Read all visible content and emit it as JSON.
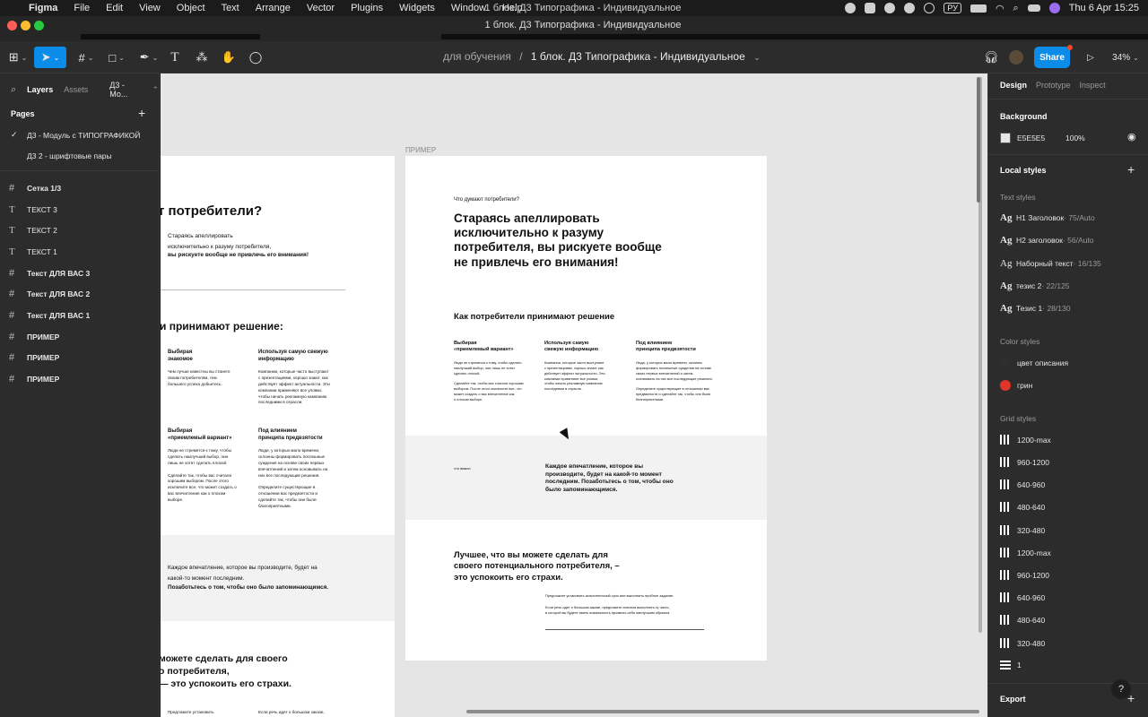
{
  "menubar": {
    "app": "Figma",
    "items": [
      "File",
      "Edit",
      "View",
      "Object",
      "Text",
      "Arrange",
      "Vector",
      "Plugins",
      "Widgets",
      "Window",
      "Help"
    ],
    "window_title": "1 блок. Д3 Типографика - Индивидуальное",
    "input_source": "РУ",
    "clock": "Thu 6 Apr  15:25"
  },
  "toolbar": {
    "breadcrumb_project": "для обучения",
    "breadcrumb_sep": "/",
    "breadcrumb_file": "1 блок. Д3 Типографика - Индивидуальное",
    "share_label": "Share",
    "zoom": "34%"
  },
  "left_panel": {
    "tabs": [
      "Layers",
      "Assets",
      "Д3 - Мо..."
    ],
    "pages_title": "Pages",
    "pages": [
      {
        "label": "Д3 - Модуль с ТИПОГРАФИКОЙ",
        "current": true
      },
      {
        "label": "Д3 2 - шрифтовые пары",
        "current": false
      }
    ],
    "layers": [
      {
        "label": "Сетка 1/3",
        "type": "frame"
      },
      {
        "label": "ТЕКСТ 3",
        "type": "text"
      },
      {
        "label": "ТЕКСТ 2",
        "type": "text"
      },
      {
        "label": "ТЕКСТ 1",
        "type": "text"
      },
      {
        "label": "Текст ДЛЯ ВАС 3",
        "type": "frame"
      },
      {
        "label": "Текст ДЛЯ ВАС 2",
        "type": "frame"
      },
      {
        "label": "Текст ДЛЯ ВАС 1",
        "type": "frame"
      },
      {
        "label": "ПРИМЕР",
        "type": "frame"
      },
      {
        "label": "ПРИМЕР",
        "type": "frame"
      },
      {
        "label": "ПРИМЕР",
        "type": "frame"
      }
    ]
  },
  "canvas": {
    "frame_label": "ПРИМЕР",
    "left_frame": {
      "heading": "т потребители?",
      "intro": "Стараясь апеллировать\nисключительно к разуму потребителя,",
      "intro_bold": "вы рискуете вообще не привлечь его внимания!",
      "section": "и принимают решение:",
      "c1_title": "Выбирая\nзнакомое",
      "c1_body": "Чем лучше известны вы станете\nсвоим потребителям, тем\nбольшего успеха добьетесь.",
      "c2_title": "Используя самую свежую\nинформацию",
      "c2_body": "Компании, которые часто выступают\nс презентациями, хорошо знают, как\nдействует эффект актуальности. Эти\nкомпании применяют все уловки,\nчтобы начать рекламную кампанию\nпоследними в отрасли.",
      "c3_title": "Выбирая\n«приемлемый вариант»",
      "c3_body": "Люди не стремятся к тому, чтобы\nсделать наилучший выбор, они\nлишь не хотят сделать плохой.\n\nСделайте так, чтобы вас считали\nхорошим выбором. После этого\nисключите все, что может создать о\nвас впечатление как о плохом\nвыборе.",
      "c4_title": "Под влиянием\nпринципа предвзятости",
      "c4_body": "Люди, у которых мало времени,\nсклонны формировать поспешные\nсуждения на основе своих первых\nвпечатлений и затем основывать на\nних все последующие решения.\n\nОпределите существующие в\nотношении вас предвзятости и\nсделайте так, чтобы они были\nблагоприятными.",
      "band_text": "Каждое впечатление, которое вы производите, будет на\nкакой-то момент последним.",
      "band_bold": "Позаботьтесь о том, чтобы оно было запоминающимся.",
      "bottom_heading": "можете сделать для своего\nо потребителя,\n— это успокоить его страхи.",
      "bottom_c1": "Предложите установить",
      "bottom_c2": "Если речь идет о большом заказе,"
    },
    "main_frame": {
      "eyebrow": "Что думают потребители?",
      "headline": "Стараясь апеллировать\nисключительно к разуму\nпотребителя, вы рискуете вообще\nне привлечь его внимания!",
      "section": "Как потребители принимают решение",
      "c1_title": "Выбирая\n«приемлемый вариант»",
      "c1_body": "Люди не стремятся к тому, чтобы сделать\nнаилучший выбор, они лишь не хотят\nсделать плохой.\n\nСделайте так, чтобы вас считали хорошим\nвыбором. После этого исключите все, что\nможет создать о вас впечатление как\nо плохом выборе.",
      "c2_title": "Используя самую\nсвежую информацию",
      "c2_body": "Компании, которые часто выступают\nс презентациями, хорошо знают, как\nдействует эффект актуальности. Эти\nкомпании применяют все уловки,\nчтобы начать рекламную кампанию\nпоследними в отрасли.",
      "c3_title": "Под влиянием\nпринципа предвзятости",
      "c3_body": "Люди, у которых мало времени, склонны\nформировать поспешные суждения на основе\nсвоих первых впечатлений и затем\nосновывать на них все последующие решения.\n\nОпределите существующие в отношении вас\nпредвзятости и сделайте так, чтобы они были\nблагоприятными.",
      "band_label": "что важно",
      "band_quote": "Каждое впечатление, которое вы\nпроизводите, будет на какой-то момент\nпоследним. Позаботьтесь о том, чтобы оно\nбыло запоминающимся.",
      "bottom_heading": "Лучшее, что вы можете сделать для\nсвоего потенциального потребителя, –\nэто успокоить его страхи.",
      "bottom_p1": "Предложите установить испытательный срок или выполнить пробное задание.",
      "bottom_p2": "Если речь идет о большом заказе, предложите сначала выполнить ту часть,\nв которой вы будете иметь возможность проявить себя наилучшим образом."
    }
  },
  "right_panel": {
    "tabs": [
      "Design",
      "Prototype",
      "Inspect"
    ],
    "background_title": "Background",
    "bg_hex": "E5E5E5",
    "bg_opacity": "100%",
    "bg_color": "#e5e5e5",
    "local_styles_title": "Local styles",
    "text_styles_title": "Text styles",
    "text_styles": [
      {
        "name": "H1 Заголовок",
        "meta": " · 75/Auto"
      },
      {
        "name": "H2 заголовок",
        "meta": " · 56/Auto"
      },
      {
        "name": "Наборный текст",
        "meta": " · 16/135"
      },
      {
        "name": "тезис 2",
        "meta": " · 22/125"
      },
      {
        "name": "Тезис 1",
        "meta": " · 28/130"
      }
    ],
    "color_styles_title": "Color styles",
    "color_styles": [
      {
        "name": "цвет описания",
        "color": "#2e2e2e"
      },
      {
        "name": "грин",
        "color": "#e2342a"
      }
    ],
    "grid_styles_title": "Grid styles",
    "grid_styles": [
      "1200-max",
      "960-1200",
      "640-960",
      "480-640",
      "320-480",
      "1200-max",
      "960-1200",
      "640-960",
      "480-640",
      "320-480"
    ],
    "grid_last": "1",
    "export_title": "Export",
    "help": "?"
  }
}
